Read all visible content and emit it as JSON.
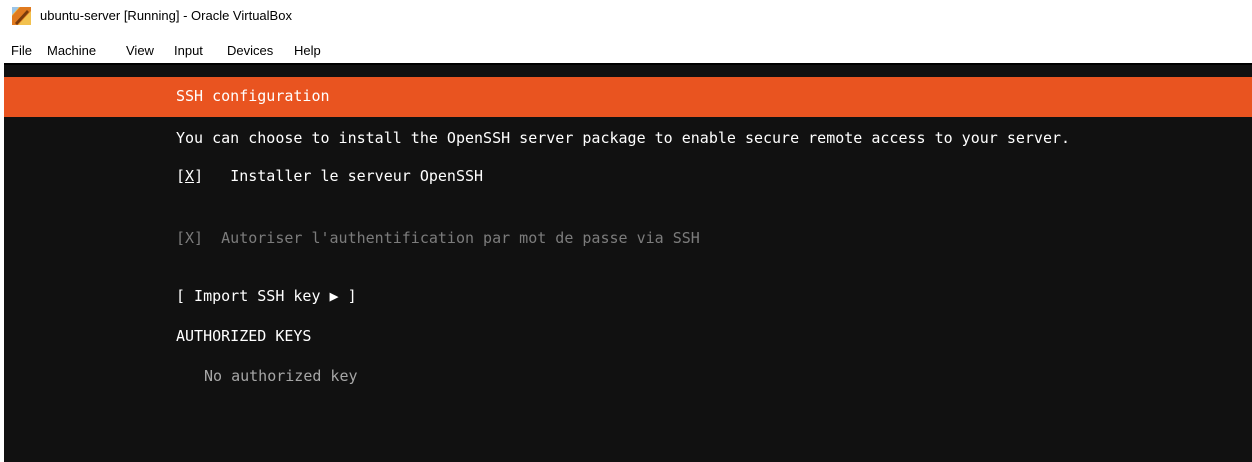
{
  "window": {
    "title": "ubuntu-server [Running] - Oracle VirtualBox",
    "icon": "virtualbox-app-icon"
  },
  "menubar": {
    "items": [
      "File",
      "Machine",
      "View",
      "Input",
      "Devices",
      "Help"
    ]
  },
  "colors": {
    "accent": "#e95420",
    "screen_bg": "#111111",
    "text": "#ffffff",
    "disabled_text": "#7c7c7c"
  },
  "installer": {
    "header": "SSH configuration",
    "description": "You can choose to install the OpenSSH server package to enable secure remote access to your server.",
    "install_checkbox": {
      "box_open": "[",
      "box_mark": "X",
      "box_close": "]",
      "label": "Installer le serveur OpenSSH",
      "checked": true
    },
    "password_auth_checkbox": {
      "box": "[X]",
      "label": "Autoriser l'authentification par mot de passe via SSH",
      "checked": true,
      "disabled": true
    },
    "import_key_button": "[ Import SSH key ▶ ]",
    "authorized_keys_heading": "AUTHORIZED KEYS",
    "no_keys_text": "No authorized key"
  }
}
